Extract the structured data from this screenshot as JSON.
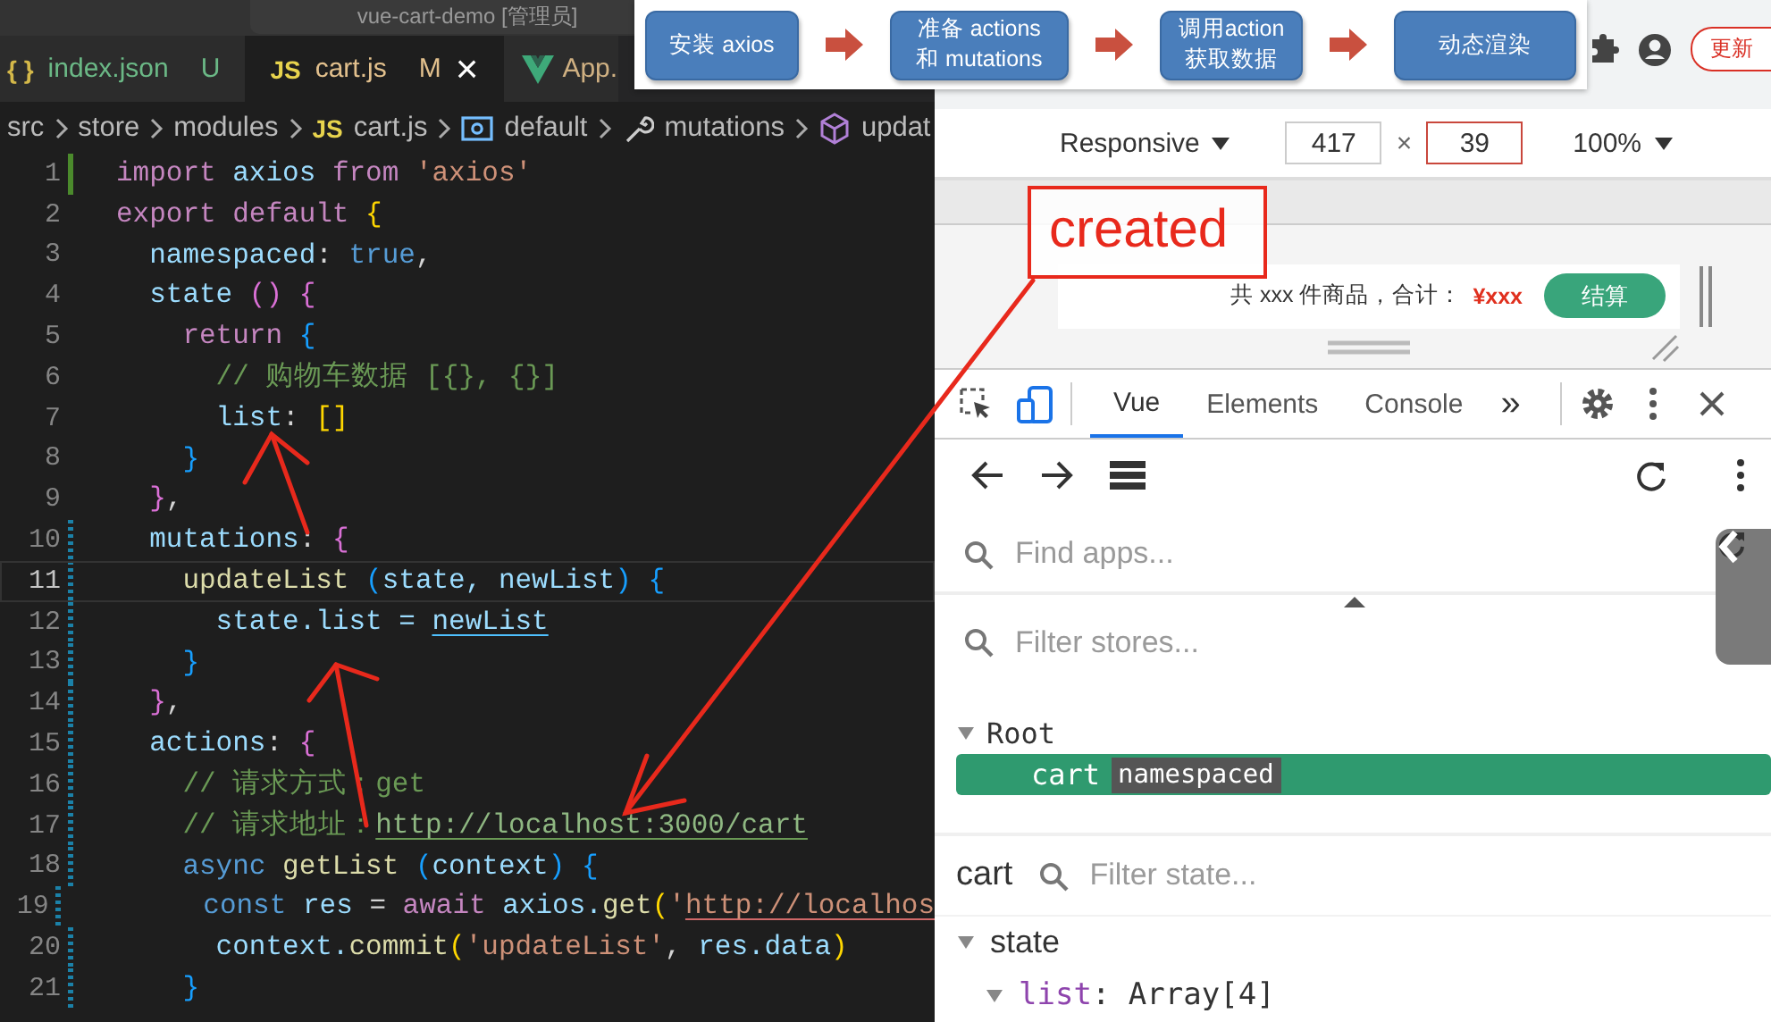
{
  "editor": {
    "title": "vue-cart-demo [管理员]",
    "tabs": [
      {
        "kind": "json",
        "badge": "{ }",
        "label": "index.json",
        "status": "U",
        "selected": false
      },
      {
        "kind": "js",
        "badge": "JS",
        "label": "cart.js",
        "status": "M",
        "close": "×",
        "selected": true
      },
      {
        "kind": "vue",
        "label": "App.",
        "selected": false
      }
    ],
    "breadcrumbs": [
      {
        "kind": "plain",
        "label": "src"
      },
      {
        "kind": "plain",
        "label": "store"
      },
      {
        "kind": "plain",
        "label": "modules"
      },
      {
        "kind": "js",
        "badge": "JS",
        "label": "cart.js"
      },
      {
        "kind": "variable",
        "label": "default"
      },
      {
        "kind": "wrench",
        "label": "mutations"
      },
      {
        "kind": "cube",
        "label": "updat"
      }
    ],
    "lines": [
      {
        "number": "1",
        "added": true,
        "modified": false,
        "current": false,
        "tokens": [
          {
            "text": "import",
            "kind": "kw"
          },
          {
            "text": " axios ",
            "kind": "var"
          },
          {
            "text": "from",
            "kind": "kw"
          },
          {
            "text": " 'axios'",
            "kind": "str"
          }
        ]
      },
      {
        "number": "2",
        "added": false,
        "modified": false,
        "current": false,
        "tokens": [
          {
            "text": "export default",
            "kind": "kw"
          },
          {
            "text": " {",
            "kind": "b1"
          }
        ]
      },
      {
        "number": "3",
        "added": false,
        "modified": false,
        "current": false,
        "tokens": [
          {
            "text": "  namespaced",
            "kind": "var"
          },
          {
            "text": ": ",
            "kind": "plain"
          },
          {
            "text": "true",
            "kind": "storage"
          },
          {
            "text": ",",
            "kind": "plain"
          }
        ]
      },
      {
        "number": "4",
        "added": false,
        "modified": false,
        "current": false,
        "tokens": [
          {
            "text": "  state ",
            "kind": "var"
          },
          {
            "text": "()",
            "kind": "b2"
          },
          {
            "text": " {",
            "kind": "b2"
          }
        ]
      },
      {
        "number": "5",
        "added": false,
        "modified": false,
        "current": false,
        "tokens": [
          {
            "text": "    return",
            "kind": "kw"
          },
          {
            "text": " {",
            "kind": "b3"
          }
        ]
      },
      {
        "number": "6",
        "added": false,
        "modified": false,
        "current": false,
        "tokens": [
          {
            "text": "      // 购物车数据 [{}, {}]",
            "kind": "com"
          }
        ]
      },
      {
        "number": "7",
        "added": false,
        "modified": false,
        "current": false,
        "tokens": [
          {
            "text": "      list",
            "kind": "var"
          },
          {
            "text": ": ",
            "kind": "plain"
          },
          {
            "text": "[]",
            "kind": "b1"
          }
        ]
      },
      {
        "number": "8",
        "added": false,
        "modified": false,
        "current": false,
        "tokens": [
          {
            "text": "    }",
            "kind": "b3"
          }
        ]
      },
      {
        "number": "9",
        "added": false,
        "modified": false,
        "current": false,
        "tokens": [
          {
            "text": "  }",
            "kind": "b2"
          },
          {
            "text": ",",
            "kind": "plain"
          }
        ]
      },
      {
        "number": "10",
        "added": false,
        "modified": true,
        "current": false,
        "tokens": [
          {
            "text": "  mutations",
            "kind": "var"
          },
          {
            "text": ": ",
            "kind": "plain"
          },
          {
            "text": "{",
            "kind": "b2"
          }
        ]
      },
      {
        "number": "11",
        "added": false,
        "modified": true,
        "current": true,
        "tokens": [
          {
            "text": "    updateList ",
            "kind": "fn"
          },
          {
            "text": "(",
            "kind": "b3"
          },
          {
            "text": "state, newList",
            "kind": "var"
          },
          {
            "text": ")",
            "kind": "b3"
          },
          {
            "text": " {",
            "kind": "b3"
          }
        ]
      },
      {
        "number": "12",
        "added": false,
        "modified": true,
        "current": false,
        "tokens": [
          {
            "text": "      state.list = ",
            "kind": "var"
          },
          {
            "text": "newList",
            "kind": "link"
          }
        ]
      },
      {
        "number": "13",
        "added": false,
        "modified": true,
        "current": false,
        "tokens": [
          {
            "text": "    }",
            "kind": "b3"
          }
        ]
      },
      {
        "number": "14",
        "added": false,
        "modified": true,
        "current": false,
        "tokens": [
          {
            "text": "  }",
            "kind": "b2"
          },
          {
            "text": ",",
            "kind": "plain"
          }
        ]
      },
      {
        "number": "15",
        "added": false,
        "modified": true,
        "current": false,
        "tokens": [
          {
            "text": "  actions",
            "kind": "var"
          },
          {
            "text": ": ",
            "kind": "plain"
          },
          {
            "text": "{",
            "kind": "b2"
          }
        ]
      },
      {
        "number": "16",
        "added": false,
        "modified": true,
        "current": false,
        "tokens": [
          {
            "text": "    // 请求方式：get",
            "kind": "com"
          }
        ]
      },
      {
        "number": "17",
        "added": false,
        "modified": true,
        "current": false,
        "tokens": [
          {
            "text": "    // 请求地址：",
            "kind": "com"
          },
          {
            "text": "http://localhost:3000/cart",
            "kind": "comlink"
          }
        ]
      },
      {
        "number": "18",
        "added": false,
        "modified": true,
        "current": false,
        "tokens": [
          {
            "text": "    async",
            "kind": "storage"
          },
          {
            "text": " getList ",
            "kind": "fn"
          },
          {
            "text": "(",
            "kind": "b3"
          },
          {
            "text": "context",
            "kind": "var"
          },
          {
            "text": ")",
            "kind": "b3"
          },
          {
            "text": " {",
            "kind": "b3"
          }
        ]
      },
      {
        "number": "19",
        "added": false,
        "modified": true,
        "current": false,
        "tokens": [
          {
            "text": "      const",
            "kind": "storage"
          },
          {
            "text": " res ",
            "kind": "var"
          },
          {
            "text": "= ",
            "kind": "plain"
          },
          {
            "text": "await",
            "kind": "kw"
          },
          {
            "text": " axios.",
            "kind": "var"
          },
          {
            "text": "get",
            "kind": "fn"
          },
          {
            "text": "(",
            "kind": "b1"
          },
          {
            "text": "'",
            "kind": "str"
          },
          {
            "text": "http://localhos",
            "kind": "strlink"
          }
        ]
      },
      {
        "number": "20",
        "added": false,
        "modified": true,
        "current": false,
        "tokens": [
          {
            "text": "      context.",
            "kind": "var"
          },
          {
            "text": "commit",
            "kind": "fn"
          },
          {
            "text": "(",
            "kind": "b1"
          },
          {
            "text": "'updateList'",
            "kind": "str"
          },
          {
            "text": ", ",
            "kind": "plain"
          },
          {
            "text": "res.data",
            "kind": "var"
          },
          {
            "text": ")",
            "kind": "b1"
          }
        ]
      },
      {
        "number": "21",
        "added": false,
        "modified": true,
        "current": false,
        "tokens": [
          {
            "text": "    }",
            "kind": "b3"
          }
        ]
      }
    ]
  },
  "flow": {
    "steps": [
      "安装 axios",
      "准备 actions\n和 mutations",
      "调用action\n获取数据",
      "动态渲染"
    ]
  },
  "browser": {
    "update_button": "更新",
    "device_toolbar": {
      "device": "Responsive",
      "width": {
        "value": "417",
        "focused": false
      },
      "times": "×",
      "height": {
        "value": "39",
        "focused": true
      },
      "zoom": "100%"
    },
    "cart_bar": {
      "summary": "共 xxx 件商品，合计：",
      "price": "¥xxx",
      "checkout": "结算"
    }
  },
  "devtools": {
    "tabs": [
      {
        "label": "Vue",
        "selected": true
      },
      {
        "label": "Elements",
        "selected": false
      },
      {
        "label": "Console",
        "selected": false
      }
    ],
    "more": "»",
    "find_apps": {
      "placeholder": "Find apps..."
    },
    "filter_stores": {
      "placeholder": "Filter stores..."
    },
    "stores": [
      {
        "label": "Root",
        "expanded": true,
        "selected": false,
        "children": [
          {
            "label": "cart",
            "badge": "namespaced",
            "selected": true
          }
        ]
      }
    ],
    "inspector": {
      "title": "cart",
      "filter": {
        "placeholder": "Filter state..."
      },
      "state": [
        {
          "label": "state",
          "expanded": true,
          "children": [
            {
              "key": "list",
              "separator": ":",
              "value": "Array[4]",
              "expanded": true
            }
          ]
        }
      ]
    }
  },
  "annotation": {
    "label": "created"
  }
}
